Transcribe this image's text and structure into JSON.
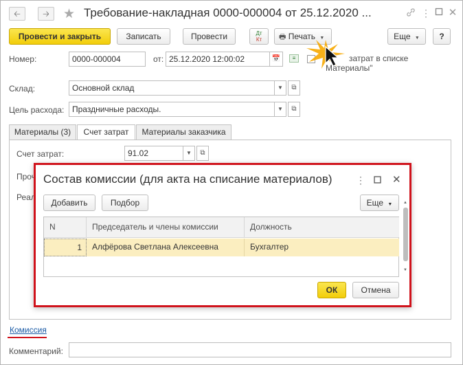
{
  "window": {
    "title": "Требование-накладная 0000-000004 от 25.12.2020 ...",
    "back_icon": "arrow-left",
    "forward_icon": "arrow-right",
    "star_icon": "star",
    "link_icon": "link",
    "menu_icon": "more-vertical",
    "maximize_icon": "square",
    "close_icon": "x"
  },
  "toolbar": {
    "post_close_label": "Провести и закрыть",
    "save_label": "Записать",
    "post_label": "Провести",
    "dt_kt_label": "Дт\nКт",
    "print_label": "Печать",
    "more_label": "Еще",
    "help_label": "?"
  },
  "form": {
    "number_label": "Номер:",
    "number_value": "0000-000004",
    "date_label": "от:",
    "date_value": "25.12.2020 12:00:02",
    "checkbox_label_line1": "затрат в списке",
    "checkbox_label_line2": "Материалы\"",
    "warehouse_label": "Склад:",
    "warehouse_value": "Основной склад",
    "purpose_label": "Цель расхода:",
    "purpose_value": "Праздничные расходы.",
    "commission_link": "Комиссия",
    "comment_label": "Комментарий:",
    "comment_value": ""
  },
  "tabs": [
    {
      "label": "Материалы (3)",
      "active": false
    },
    {
      "label": "Счет затрат",
      "active": true
    },
    {
      "label": "Материалы заказчика",
      "active": false
    }
  ],
  "tab_content": {
    "account_label": "Счет затрат:",
    "account_value": "91.02",
    "other_label_partial": "Проч",
    "real_label_partial": "Реал"
  },
  "modal": {
    "title": "Состав комиссии (для акта на списание материалов)",
    "add_label": "Добавить",
    "select_label": "Подбор",
    "more_label": "Еще",
    "ok_label": "ОК",
    "cancel_label": "Отмена",
    "columns": [
      "N",
      "Председатель и члены комиссии",
      "Должность"
    ],
    "rows": [
      {
        "n": "1",
        "name": "Алфёрова Светлана Алексеевна",
        "position": "Бухгалтер"
      }
    ]
  },
  "colors": {
    "accent_yellow": "#f5d11c",
    "highlight_red": "#d0121b",
    "link_blue": "#1a5aa5",
    "row_selected": "#fbeec0"
  }
}
